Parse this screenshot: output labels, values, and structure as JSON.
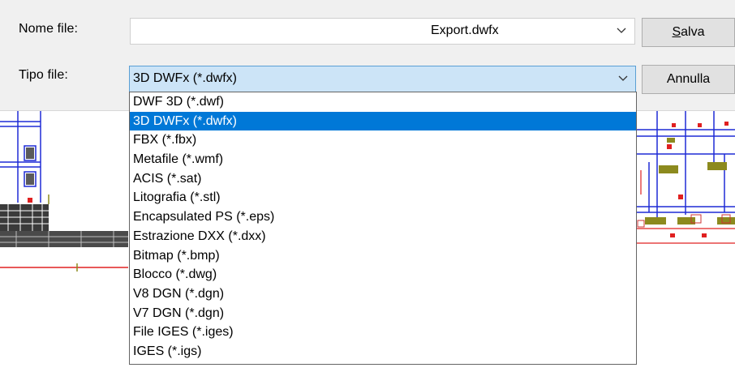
{
  "dialog": {
    "filename_label": "Nome file:",
    "filename_value": "Export.dwfx",
    "filetype_label": "Tipo file:",
    "filetype_value": "3D DWFx (*.dwfx)",
    "save_label": "Salva",
    "cancel_label": "Annulla"
  },
  "filetypes": [
    "DWF 3D (*.dwf)",
    "3D DWFx (*.dwfx)",
    "FBX (*.fbx)",
    "Metafile (*.wmf)",
    "ACIS (*.sat)",
    "Litografia (*.stl)",
    "Encapsulated PS (*.eps)",
    "Estrazione DXX (*.dxx)",
    "Bitmap (*.bmp)",
    "Blocco (*.dwg)",
    "V8 DGN (*.dgn)",
    "V7 DGN (*.dgn)",
    "File IGES (*.iges)",
    "IGES (*.igs)"
  ],
  "selected_index": 1,
  "icons": {
    "dropdown": "chevron-down-icon"
  },
  "colors": {
    "selection": "#0078d7",
    "combo_focus": "#cce4f7",
    "cad_blue": "#1f2bd6",
    "cad_red": "#e02020",
    "cad_olive": "#8c8a1e"
  }
}
